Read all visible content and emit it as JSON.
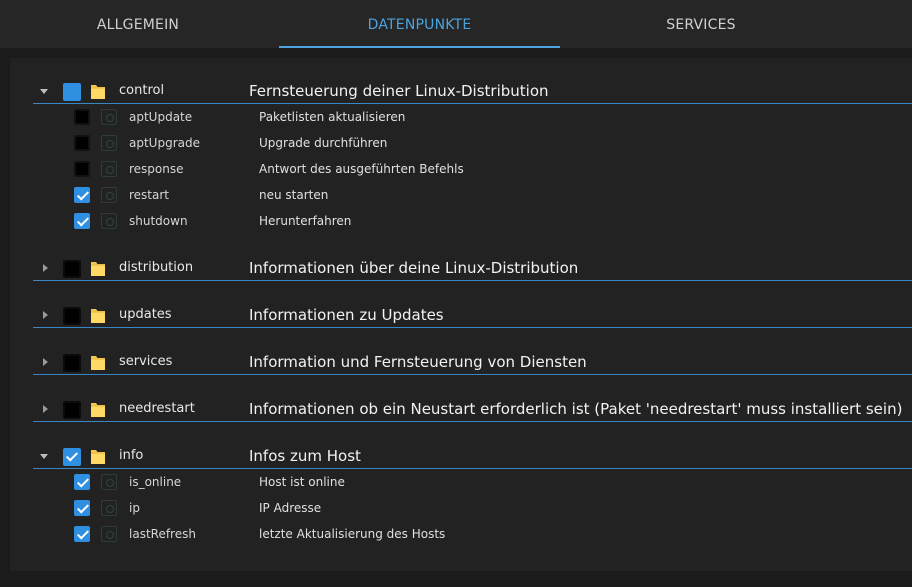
{
  "tabs": [
    {
      "label": "ALLGEMEIN",
      "active": false
    },
    {
      "label": "DATENPUNKTE",
      "active": true
    },
    {
      "label": "SERVICES",
      "active": false
    }
  ],
  "accent_color": "#2f8fe0",
  "tree": [
    {
      "name": "control",
      "description": "Fernsteuerung deiner Linux-Distribution",
      "expanded": true,
      "state": "indeterminate",
      "children": [
        {
          "name": "aptUpdate",
          "description": "Paketlisten aktualisieren",
          "checked": false
        },
        {
          "name": "aptUpgrade",
          "description": "Upgrade durchführen",
          "checked": false
        },
        {
          "name": "response",
          "description": "Antwort des ausgeführten Befehls",
          "checked": false
        },
        {
          "name": "restart",
          "description": "neu starten",
          "checked": true
        },
        {
          "name": "shutdown",
          "description": "Herunterfahren",
          "checked": true
        }
      ]
    },
    {
      "name": "distribution",
      "description": "Informationen über deine Linux-Distribution",
      "expanded": false,
      "state": "unchecked",
      "children": []
    },
    {
      "name": "updates",
      "description": "Informationen zu Updates",
      "expanded": false,
      "state": "unchecked",
      "children": []
    },
    {
      "name": "services",
      "description": "Information und Fernsteuerung von Diensten",
      "expanded": false,
      "state": "unchecked",
      "children": []
    },
    {
      "name": "needrestart",
      "description": "Informationen ob ein Neustart erforderlich ist (Paket 'needrestart' muss installiert sein)",
      "expanded": false,
      "state": "unchecked",
      "children": []
    },
    {
      "name": "info",
      "description": "Infos zum Host",
      "expanded": true,
      "state": "checked",
      "children": [
        {
          "name": "is_online",
          "description": "Host ist online",
          "checked": true
        },
        {
          "name": "ip",
          "description": "IP Adresse",
          "checked": true
        },
        {
          "name": "lastRefresh",
          "description": "letzte Aktualisierung des Hosts",
          "checked": true
        }
      ]
    }
  ]
}
